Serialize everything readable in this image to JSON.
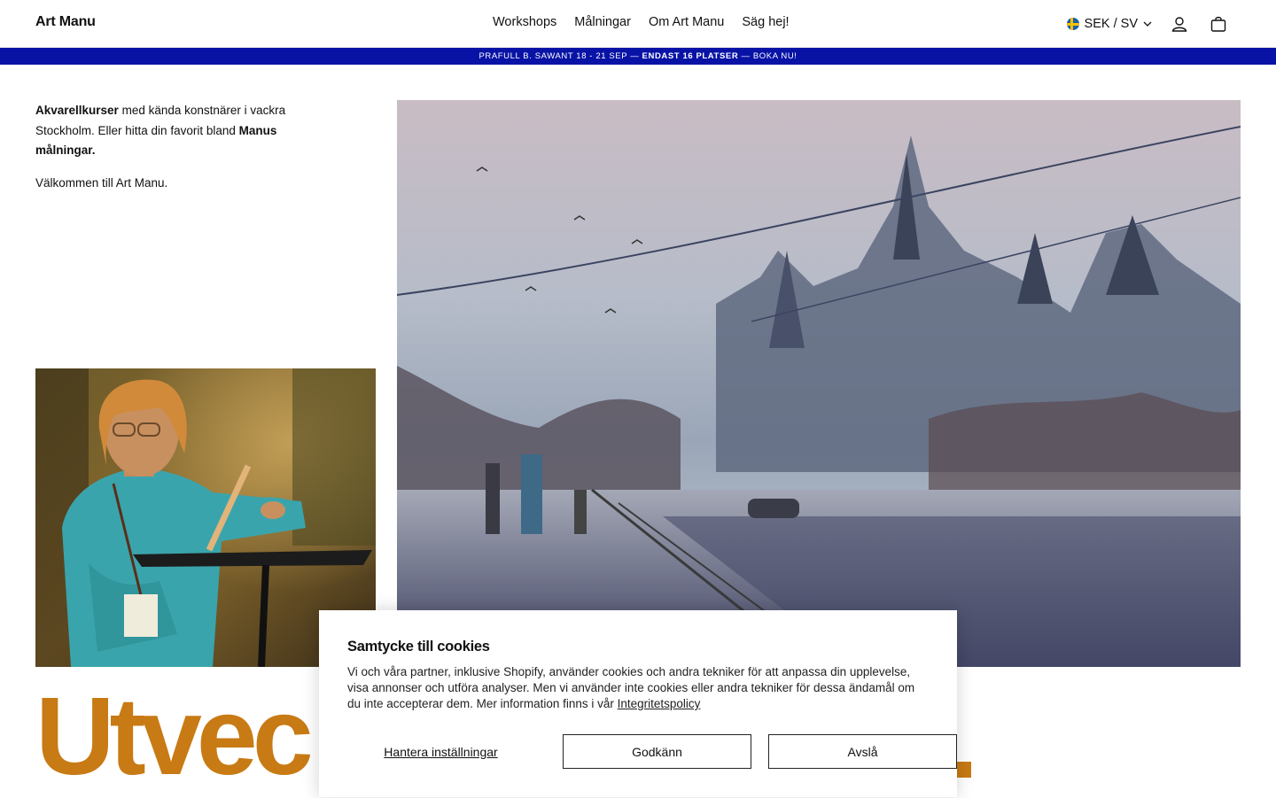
{
  "header": {
    "logo": "Art Manu",
    "nav": [
      "Workshops",
      "Målningar",
      "Om Art Manu",
      "Säg hej!"
    ],
    "locale": "SEK / SV",
    "icons": [
      "sweden-flag-icon",
      "chevron-down-icon",
      "user-icon",
      "bag-icon"
    ]
  },
  "announcement": {
    "part1": "PRAFULL B. SAWANT 18 - 21 SEP — ",
    "bold": "ENDAST 16 PLATSER",
    "part2": " — BOKA NU!"
  },
  "intro": {
    "bold1": "Akvarellkurser",
    "text1": " med kända konstnärer i vackra Stockholm. Eller hitta din favorit bland ",
    "bold2": "Manus målningar.",
    "welcome": "Välkommen till Art Manu."
  },
  "headline": "Utvec",
  "cookie": {
    "title": "Samtycke till cookies",
    "body": "Vi och våra partner, inklusive Shopify, använder cookies och andra tekniker för att anpassa din upplevelse, visa annonser och utföra analyser. Men vi använder inte cookies eller andra tekniker för dessa ändamål om du inte accepterar dem. Mer information finns i vår ",
    "policy_link": "Integritetspolicy",
    "manage": "Hantera inställningar",
    "accept": "Godkänn",
    "decline": "Avslå"
  },
  "colors": {
    "announcement_bg": "#0813a6",
    "headline": "#c87a14"
  }
}
